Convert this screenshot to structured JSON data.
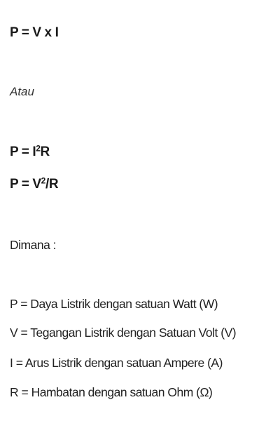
{
  "formula_main": "P = V x I",
  "or_text": "Atau",
  "formula_alt1": {
    "prefix": "P = I",
    "exponent": "2",
    "suffix": "R"
  },
  "formula_alt2": {
    "prefix": "P = V",
    "exponent": "2",
    "suffix": "/R"
  },
  "where_label": "Dimana :",
  "definitions": [
    "P = Daya Listrik dengan satuan Watt (W)",
    "V = Tegangan Listrik dengan Satuan Volt (V)",
    "I = Arus Listrik dengan satuan Ampere (A)",
    "R = Hambatan dengan satuan Ohm (Ω)"
  ]
}
